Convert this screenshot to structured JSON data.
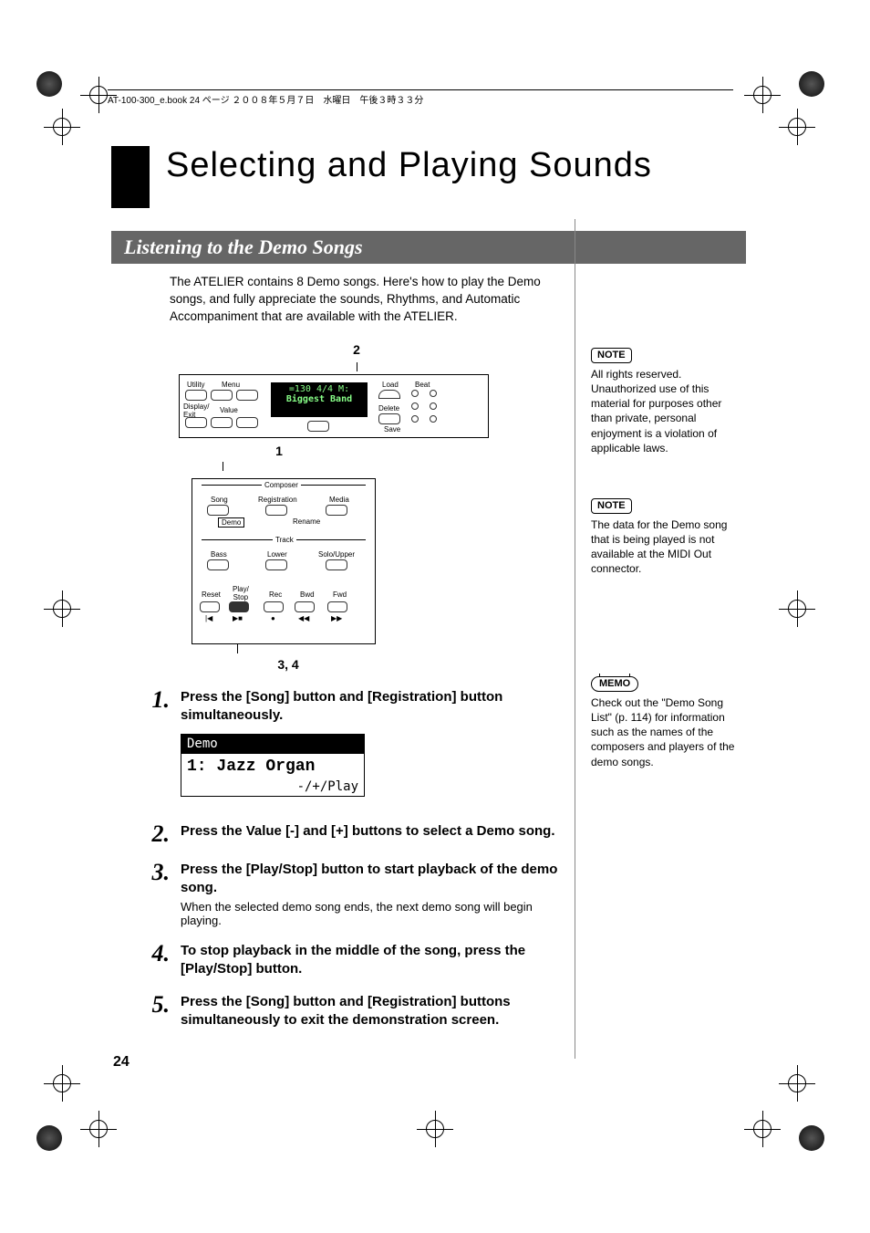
{
  "header": {
    "running": "AT-100-300_e.book  24 ページ  ２００８年５月７日　水曜日　午後３時３３分"
  },
  "chapter_title": "Selecting and Playing Sounds",
  "section_title": "Listening to the Demo Songs",
  "intro": "The ATELIER contains 8 Demo songs. Here's how to play the Demo songs, and fully appreciate the sounds, Rhythms, and Automatic Accompaniment that are available with the ATELIER.",
  "fig": {
    "callout_2": "2",
    "callout_1": "1",
    "callout_34": "3, 4",
    "panel_top": {
      "utility": "Utility",
      "menu": "Menu",
      "display_exit": "Display/\nExit",
      "value": "Value",
      "lcd_line1": "=130     4/4 M:",
      "lcd_line2": "Biggest Band",
      "load": "Load",
      "beat": "Beat",
      "delete": "Delete",
      "save": "Save"
    },
    "panel_bottom": {
      "composer": "Composer",
      "song": "Song",
      "registration": "Registration",
      "media": "Media",
      "demo": "Demo",
      "rename": "Rename",
      "track": "Track",
      "bass": "Bass",
      "lower": "Lower",
      "solo_upper": "Solo/Upper",
      "reset": "Reset",
      "play_stop": "Play/\nStop",
      "rec": "Rec",
      "bwd": "Bwd",
      "fwd": "Fwd"
    }
  },
  "lcd_demo": {
    "header": "Demo",
    "line": "1: Jazz Organ",
    "footer": "-/+/Play"
  },
  "steps": [
    {
      "num": "1.",
      "heading": "Press the [Song] button and [Registration] button simultaneously."
    },
    {
      "num": "2.",
      "heading": "Press the Value [-] and [+] buttons to select a Demo song."
    },
    {
      "num": "3.",
      "heading": "Press the [Play/Stop] button to start playback of the demo song.",
      "sub": "When the selected demo song ends, the next demo song will begin playing."
    },
    {
      "num": "4.",
      "heading": "To stop playback in the middle of the song, press the [Play/Stop] button."
    },
    {
      "num": "5.",
      "heading": "Press the [Song] button and [Registration] buttons simultaneously to exit the demonstration screen."
    }
  ],
  "sidebar": {
    "note_label": "NOTE",
    "memo_label": "MEMO",
    "note1": "All rights reserved. Unauthorized use of this material for purposes other than private, personal enjoyment is a violation of applicable laws.",
    "note2": "The data for the Demo song that is being played is not available at the MIDI Out connector.",
    "memo1": "Check out the \"Demo Song List\" (p. 114) for information such as the names of the composers and players of the demo songs."
  },
  "page_number": "24"
}
